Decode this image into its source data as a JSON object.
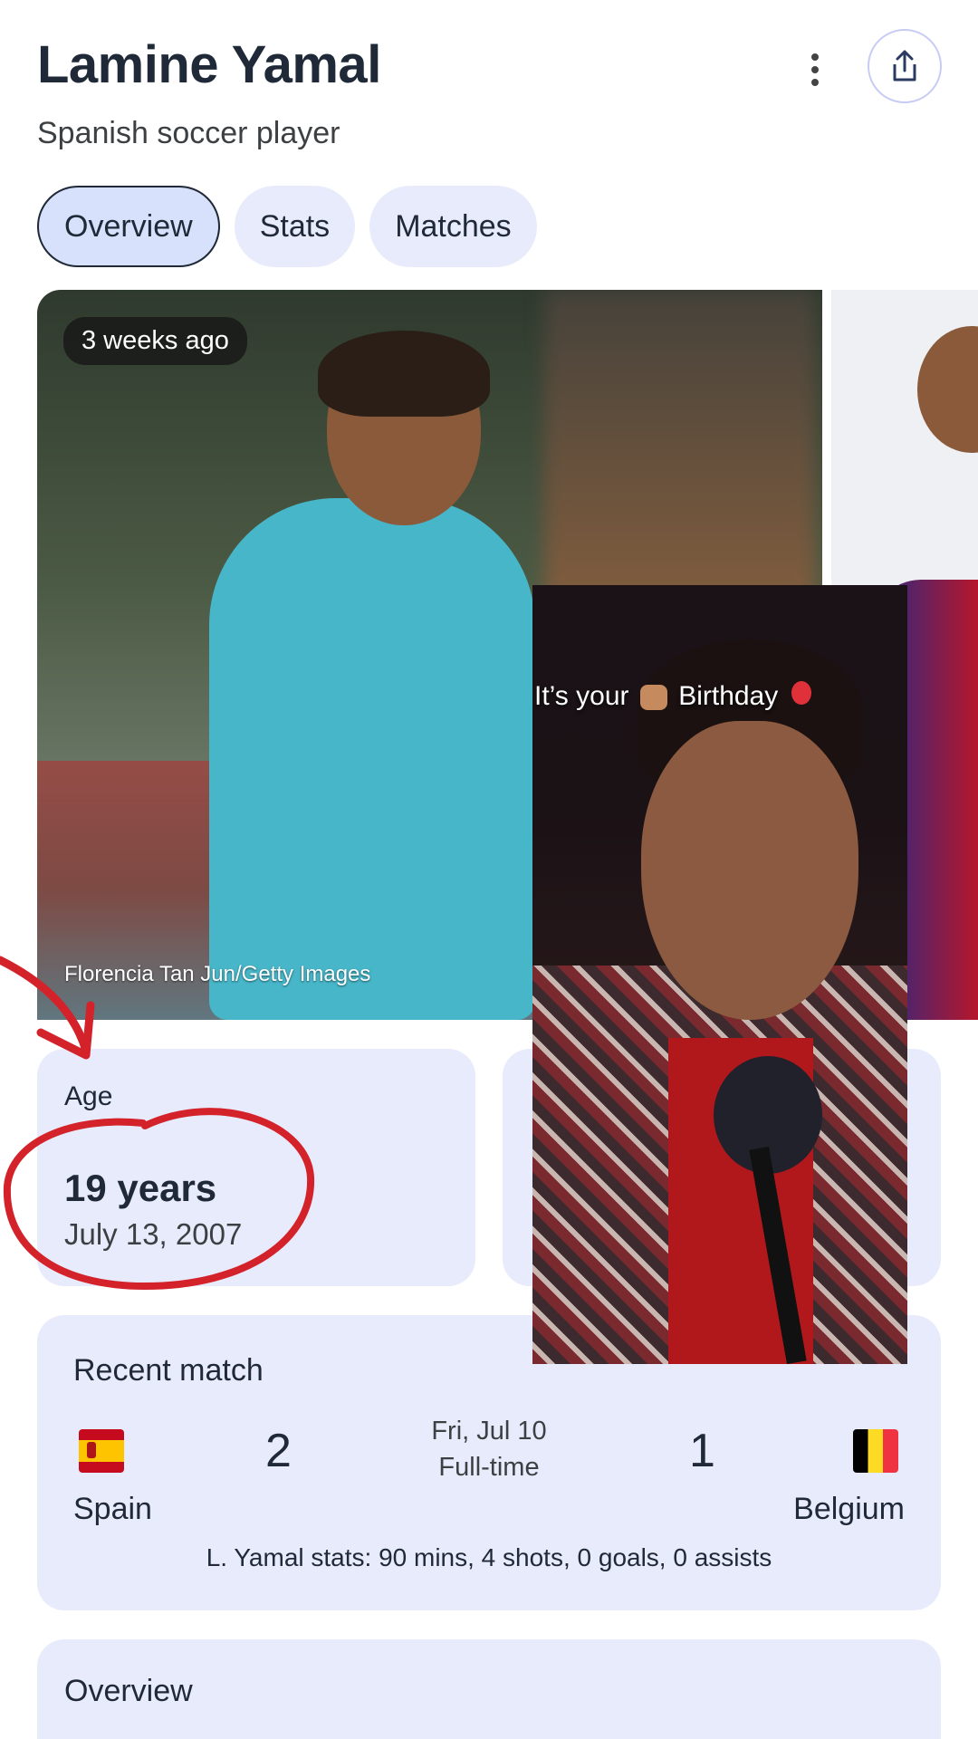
{
  "header": {
    "title": "Lamine Yamal",
    "subtitle": "Spanish soccer player"
  },
  "tabs": [
    {
      "label": "Overview",
      "active": true
    },
    {
      "label": "Stats",
      "active": false
    },
    {
      "label": "Matches",
      "active": false
    }
  ],
  "photo": {
    "time_badge": "3 weeks ago",
    "credit": "Florencia Tan Jun/Getty Images"
  },
  "age_card": {
    "label": "Age",
    "value": "19 years",
    "birth_date": "July 13, 2007"
  },
  "recent_match": {
    "title": "Recent match",
    "home_team": "Spain",
    "home_score": "2",
    "away_team": "Belgium",
    "away_score": "1",
    "date": "Fri, Jul 10",
    "status": "Full-time",
    "player_stats": "L. Yamal stats: 90 mins, 4 shots, 0 goals, 0 assists"
  },
  "overview_section": {
    "title": "Overview"
  },
  "overlay_video": {
    "caption_part1": "It’s your",
    "caption_part2": "Birthday"
  },
  "icons": {
    "more": "more-vert-icon",
    "share": "share-icon"
  },
  "colors": {
    "card_bg": "#e8ebfb",
    "active_tab_bg": "#d7e1fb",
    "annotation_red": "#d3222a"
  }
}
